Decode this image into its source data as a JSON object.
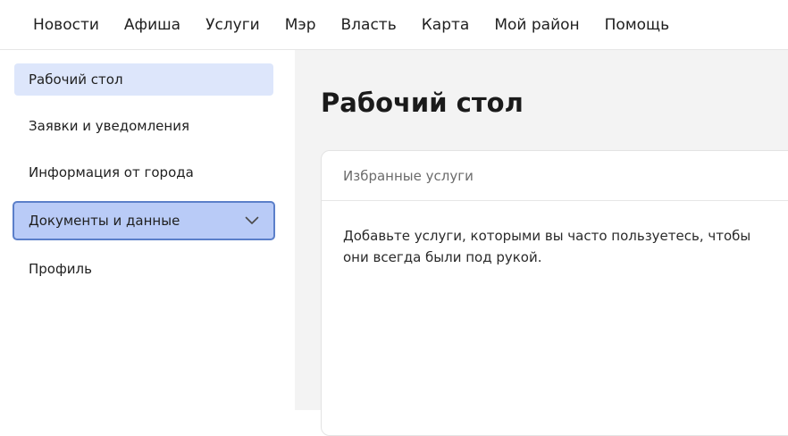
{
  "topnav": {
    "items": [
      "Новости",
      "Афиша",
      "Услуги",
      "Мэр",
      "Власть",
      "Карта",
      "Мой район",
      "Помощь"
    ]
  },
  "sidebar": {
    "items": [
      {
        "label": "Рабочий стол",
        "state": "active"
      },
      {
        "label": "Заявки и уведомления",
        "state": "normal"
      },
      {
        "label": "Информация от города",
        "state": "normal"
      },
      {
        "label": "Документы и данные",
        "state": "focused",
        "expandable": true
      },
      {
        "label": "Профиль",
        "state": "normal"
      }
    ]
  },
  "main": {
    "title": "Рабочий стол",
    "card": {
      "header": "Избранные услуги",
      "body": "Добавьте услуги, которыми вы часто пользуетесь, чтобы они всегда были под рукой."
    }
  },
  "colors": {
    "active_bg": "#dde6fb",
    "focused_bg": "#b9cbf7",
    "focused_border": "#5b7fc9",
    "main_bg": "#f3f3f3"
  },
  "icons": {
    "expand": "chevron-down-icon"
  }
}
